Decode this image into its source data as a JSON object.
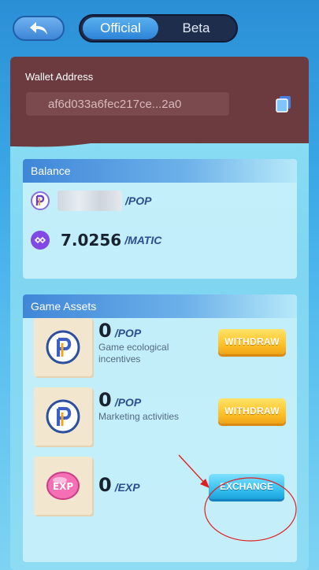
{
  "header": {
    "toggle_options": [
      "Official",
      "Beta"
    ],
    "selected": "Official"
  },
  "wallet": {
    "title": "Wallet Address",
    "address": "af6d033a6fec217ce...2a0"
  },
  "balance": {
    "title": "Balance",
    "items": [
      {
        "icon": "pop-coin-icon",
        "value": "",
        "unit": "/POP"
      },
      {
        "icon": "matic-coin-icon",
        "value": "7.0256",
        "unit": "/MATIC"
      }
    ]
  },
  "assets": {
    "title": "Game Assets",
    "items": [
      {
        "icon": "pop-token-icon",
        "amount": "0",
        "unit": "/POP",
        "description": "Game ecological incentives",
        "action": "WITHDRAW"
      },
      {
        "icon": "pop-token-icon",
        "amount": "0",
        "unit": "/POP",
        "description": "Marketing activities",
        "action": "WITHDRAW"
      },
      {
        "icon": "exp-badge-icon",
        "amount": "0",
        "unit": "/EXP",
        "description": "",
        "action": "EXCHANGE"
      }
    ]
  },
  "colors": {
    "wallet_bg": "#6b3b3f",
    "accent_blue": "#3f86d8",
    "withdraw_yellow": "#ffc226",
    "exchange_cyan": "#38c2f2",
    "annotation_red": "#e02020"
  }
}
